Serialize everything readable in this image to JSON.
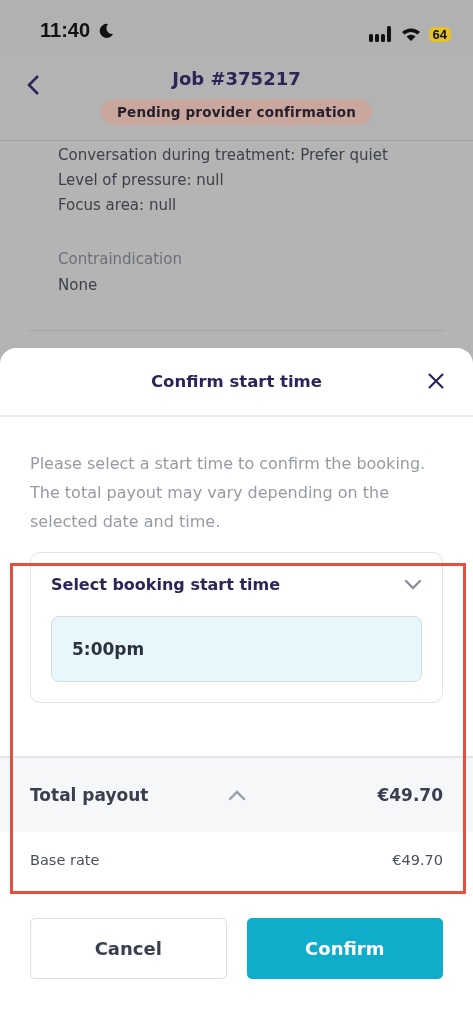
{
  "status_bar": {
    "time": "11:40",
    "battery": "64"
  },
  "header": {
    "title": "Job #375217",
    "status_badge": "Pending provider confirmation"
  },
  "details": {
    "lines": [
      "Conversation during treatment: Prefer quiet",
      "Level of pressure: null",
      "Focus area: null"
    ],
    "sections": [
      {
        "label": "Contraindication",
        "value": "None"
      }
    ]
  },
  "sheet": {
    "title": "Confirm start time",
    "description": "Please select a start time to confirm the booking. The total payout may vary depending on the selected date and time.",
    "select": {
      "label": "Select booking start time",
      "value": "5:00pm"
    },
    "payout": {
      "label": "Total payout",
      "amount": "€49.70",
      "expanded": true,
      "items": [
        {
          "label": "Base rate",
          "amount": "€49.70"
        }
      ]
    },
    "buttons": [
      {
        "label": "Cancel",
        "kind": "secondary"
      },
      {
        "label": "Confirm",
        "kind": "primary"
      }
    ]
  }
}
